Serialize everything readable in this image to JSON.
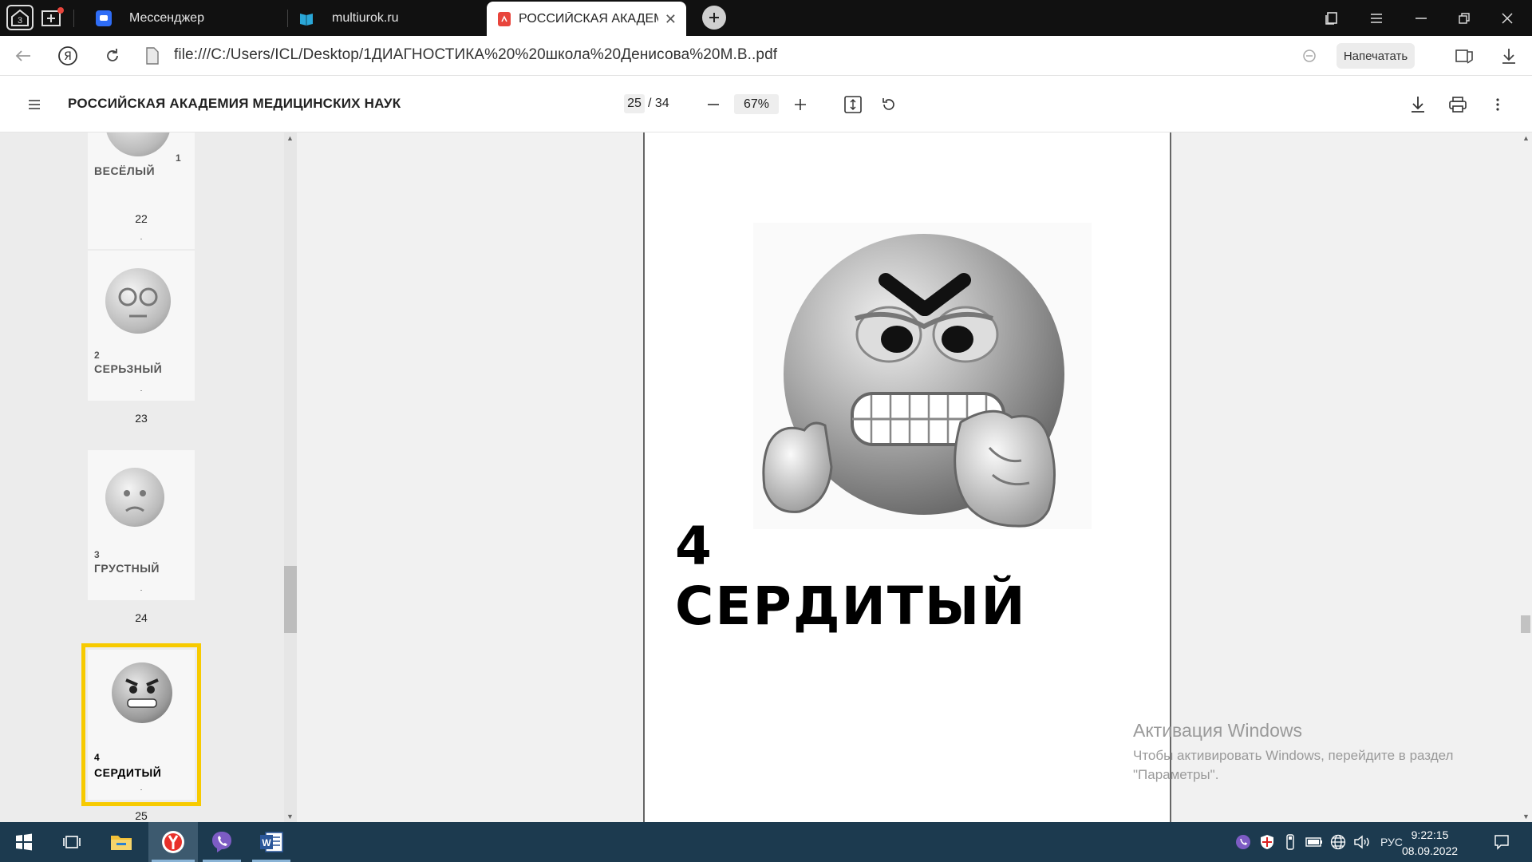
{
  "tabbar": {
    "tab_counter": "3",
    "tabs": [
      {
        "label": "Мессенджер",
        "icon": "chat-icon",
        "color": "#2f6df6"
      },
      {
        "label": "multiurok.ru",
        "icon": "book-icon",
        "color": "#2aa7d8"
      },
      {
        "label": "РОССИЙСКАЯ АКАДЕМ",
        "icon": "pdf-icon",
        "color": "#e8453c",
        "active": true
      }
    ]
  },
  "addressbar": {
    "url": "file:///C:/Users/ICL/Desktop/1ДИАГНОСТИКА%20%20школа%20Денисова%20М.В..pdf",
    "print_label": "Напечатать"
  },
  "pdfbar": {
    "title": "РОССИЙСКАЯ АКАДЕМИЯ МЕДИЦИНСКИХ НАУК",
    "current_page": "25",
    "total_pages": "/ 34",
    "zoom": "67%"
  },
  "thumbnails": [
    {
      "num": "1",
      "label": "ВЕСЁЛЫЙ",
      "page": "22"
    },
    {
      "num": "2",
      "label": "СЕРЬЗНЫЙ",
      "page": "23"
    },
    {
      "num": "3",
      "label": "ГРУСТНЫЙ",
      "page": "24"
    },
    {
      "num": "4",
      "label": "СЕРДИТЫЙ",
      "page": "25",
      "selected": true
    }
  ],
  "page_content": {
    "number": "4",
    "word": "СЕРДИТЫЙ"
  },
  "activation": {
    "title": "Активация Windows",
    "line1": "Чтобы активировать Windows, перейдите в раздел",
    "line2": "\"Параметры\"."
  },
  "taskbar": {
    "lang": "РУС",
    "time": "9:22:15",
    "date": "08.09.2022"
  },
  "colors": {
    "selection": "#f7ca00",
    "taskbar": "#1c3a4f"
  }
}
